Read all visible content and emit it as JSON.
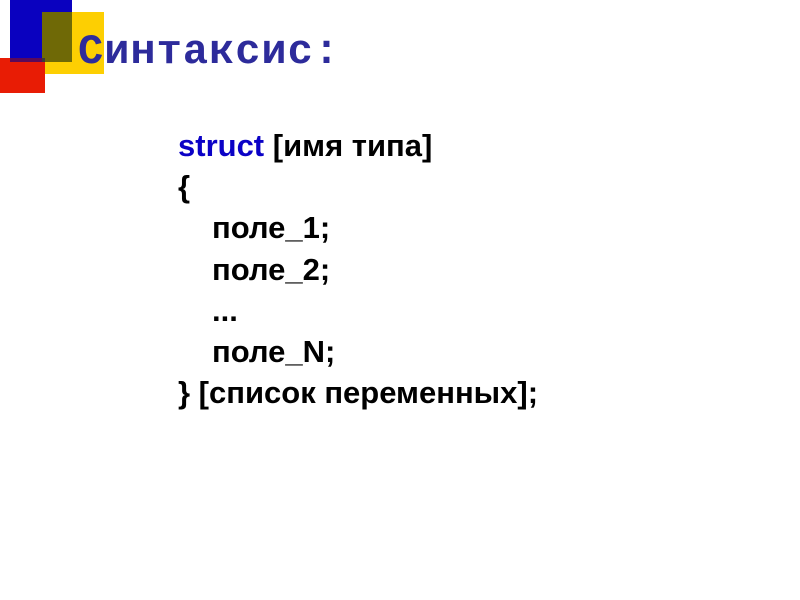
{
  "title": "Синтаксис:",
  "code": {
    "keyword": "struct",
    "typeName": "[имя типа]",
    "braceOpen": "{",
    "fields": [
      "поле_1;",
      "поле_2;",
      "...",
      "поле_N;"
    ],
    "closing": "} [список переменных];"
  }
}
